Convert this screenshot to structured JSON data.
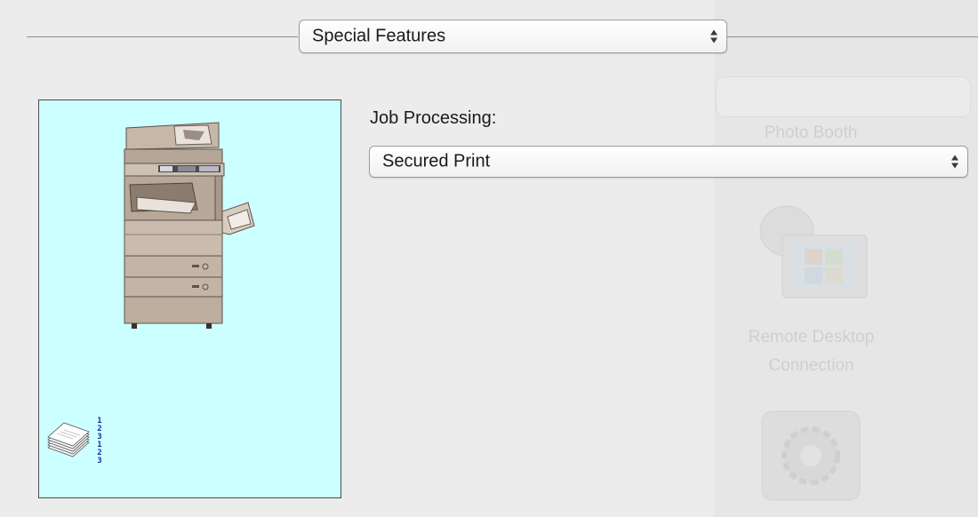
{
  "header": {
    "features_popup_value": "Special Features"
  },
  "job_processing": {
    "label": "Job Processing:",
    "value": "Secured Print"
  },
  "preview": {
    "order_digits": [
      "1",
      "2",
      "3",
      "1",
      "2",
      "3"
    ],
    "printer_icon": "printer-copier-icon",
    "stack_icon": "paper-stack-icon"
  },
  "background_window": {
    "items": [
      {
        "label": "Photo Booth"
      },
      {
        "label": "Remote Desktop Connection",
        "line1": "Remote Desktop",
        "line2": "Connection"
      }
    ]
  },
  "colors": {
    "preview_background": "#ccffff",
    "window_background": "#ececec",
    "order_text": "#1a2f9a"
  }
}
